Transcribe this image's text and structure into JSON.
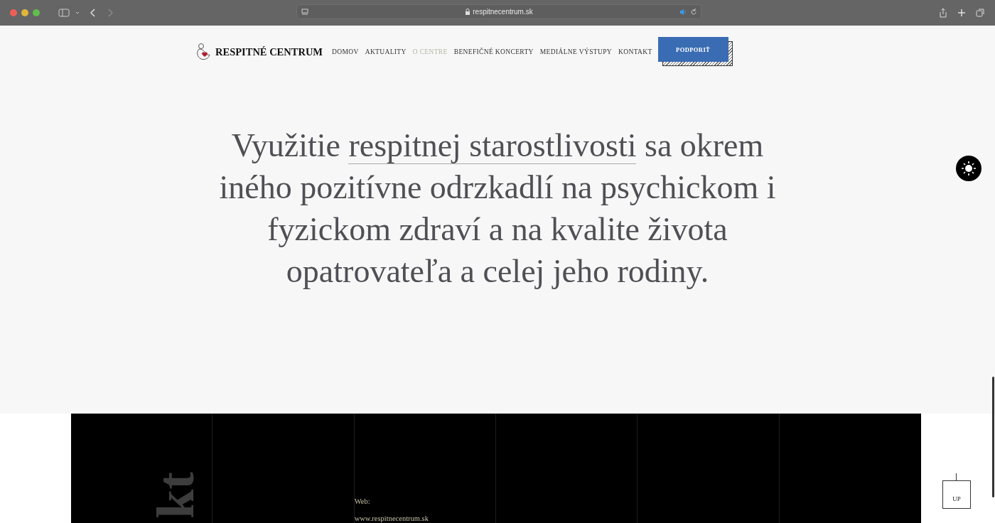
{
  "browser": {
    "url": "respitnecentrum.sk"
  },
  "header": {
    "logo": "RESPITNÉ CENTRUM",
    "nav": [
      {
        "label": "DOMOV",
        "selected": false
      },
      {
        "label": "AKTUALITY",
        "selected": false
      },
      {
        "label": "O CENTRE",
        "selected": true
      },
      {
        "label": "BENEFIČNÉ KONCERTY",
        "selected": false
      },
      {
        "label": "MEDIÁLNE VÝSTUPY",
        "selected": false
      },
      {
        "label": "KONTAKT",
        "selected": false
      }
    ],
    "cta": "PODPORIŤ"
  },
  "hero": {
    "before": "Využitie ",
    "link": "respitnej starostlivosti",
    "after": " sa okrem iného pozitívne odrzkadlí na psychickom i fyzickom zdraví a na kvalite života opatrovateľa a celej jeho rodiny."
  },
  "footer": {
    "heading": "kt",
    "web_label": "Web:",
    "web_url": "www.respitnecentrum.sk"
  },
  "up_button": "UP"
}
